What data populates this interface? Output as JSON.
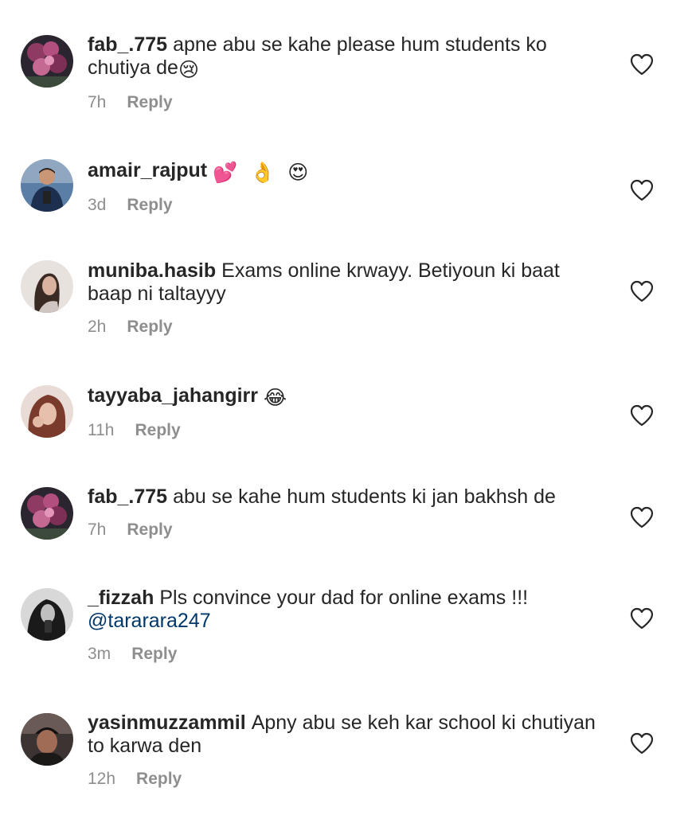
{
  "comments": [
    {
      "username": "fab_.775",
      "text": "apne abu se kahe please hum students ko chutiya de",
      "emoji": "😢",
      "time": "7h",
      "reply": "Reply"
    },
    {
      "username": "amair_rajput",
      "text": "",
      "emoji": "💕 👌 😍",
      "time": "3d",
      "reply": "Reply"
    },
    {
      "username": "muniba.hasib",
      "text": "Exams online krwayy. Betiyoun ki baat baap ni taltayyy",
      "time": "2h",
      "reply": "Reply"
    },
    {
      "username": "tayyaba_jahangirr",
      "text": "",
      "emoji": "😂",
      "time": "11h",
      "reply": "Reply"
    },
    {
      "username": "fab_.775",
      "text": "abu se kahe hum students ki jan bakhsh de",
      "time": "7h",
      "reply": "Reply"
    },
    {
      "username": "_fizzah",
      "text": "Pls convince your dad for online exams !!!",
      "mention": "@tararara247",
      "time": "3m",
      "reply": "Reply"
    },
    {
      "username": "yasinmuzzammil",
      "text": "Apny abu se keh kar school ki chutiyan to karwa den",
      "time": "12h",
      "reply": "Reply"
    }
  ],
  "colors": {
    "text": "#262626",
    "secondary": "#8e8e8e",
    "mention": "#00376b",
    "background": "#ffffff"
  }
}
